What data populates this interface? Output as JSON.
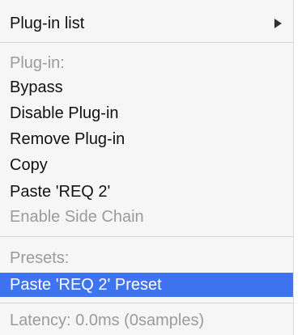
{
  "menu": {
    "plugin_list": "Plug-in list",
    "plugin_header": "Plug-in:",
    "bypass": "Bypass",
    "disable_plugin": "Disable Plug-in",
    "remove_plugin": "Remove Plug-in",
    "copy": "Copy",
    "paste": "Paste 'REQ 2'",
    "enable_side_chain": "Enable Side Chain",
    "presets_header": "Presets:",
    "paste_preset": "Paste 'REQ 2' Preset",
    "latency": "Latency: 0.0ms (0samples)"
  },
  "colors": {
    "selection": "#3f74f0",
    "disabled_text": "#9b9b9b",
    "menu_background": "#f6f6f6"
  },
  "icons": {
    "submenu_arrow": "chevron-right-icon"
  }
}
